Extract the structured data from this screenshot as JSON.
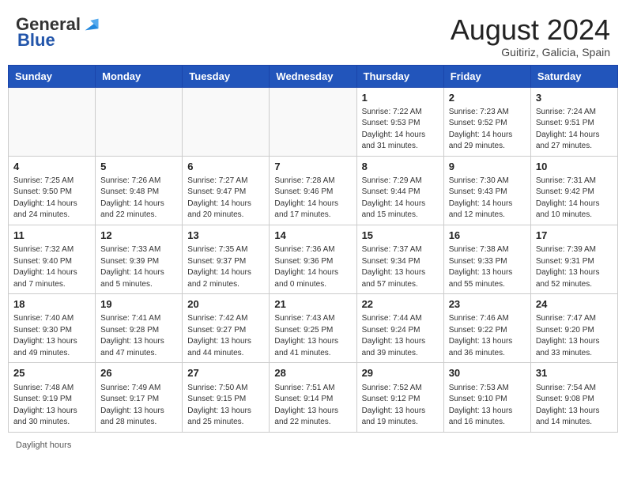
{
  "header": {
    "logo_general": "General",
    "logo_blue": "Blue",
    "month_title": "August 2024",
    "location": "Guitiriz, Galicia, Spain"
  },
  "days_of_week": [
    "Sunday",
    "Monday",
    "Tuesday",
    "Wednesday",
    "Thursday",
    "Friday",
    "Saturday"
  ],
  "weeks": [
    [
      {
        "day": "",
        "info": ""
      },
      {
        "day": "",
        "info": ""
      },
      {
        "day": "",
        "info": ""
      },
      {
        "day": "",
        "info": ""
      },
      {
        "day": "1",
        "info": "Sunrise: 7:22 AM\nSunset: 9:53 PM\nDaylight: 14 hours and 31 minutes."
      },
      {
        "day": "2",
        "info": "Sunrise: 7:23 AM\nSunset: 9:52 PM\nDaylight: 14 hours and 29 minutes."
      },
      {
        "day": "3",
        "info": "Sunrise: 7:24 AM\nSunset: 9:51 PM\nDaylight: 14 hours and 27 minutes."
      }
    ],
    [
      {
        "day": "4",
        "info": "Sunrise: 7:25 AM\nSunset: 9:50 PM\nDaylight: 14 hours and 24 minutes."
      },
      {
        "day": "5",
        "info": "Sunrise: 7:26 AM\nSunset: 9:48 PM\nDaylight: 14 hours and 22 minutes."
      },
      {
        "day": "6",
        "info": "Sunrise: 7:27 AM\nSunset: 9:47 PM\nDaylight: 14 hours and 20 minutes."
      },
      {
        "day": "7",
        "info": "Sunrise: 7:28 AM\nSunset: 9:46 PM\nDaylight: 14 hours and 17 minutes."
      },
      {
        "day": "8",
        "info": "Sunrise: 7:29 AM\nSunset: 9:44 PM\nDaylight: 14 hours and 15 minutes."
      },
      {
        "day": "9",
        "info": "Sunrise: 7:30 AM\nSunset: 9:43 PM\nDaylight: 14 hours and 12 minutes."
      },
      {
        "day": "10",
        "info": "Sunrise: 7:31 AM\nSunset: 9:42 PM\nDaylight: 14 hours and 10 minutes."
      }
    ],
    [
      {
        "day": "11",
        "info": "Sunrise: 7:32 AM\nSunset: 9:40 PM\nDaylight: 14 hours and 7 minutes."
      },
      {
        "day": "12",
        "info": "Sunrise: 7:33 AM\nSunset: 9:39 PM\nDaylight: 14 hours and 5 minutes."
      },
      {
        "day": "13",
        "info": "Sunrise: 7:35 AM\nSunset: 9:37 PM\nDaylight: 14 hours and 2 minutes."
      },
      {
        "day": "14",
        "info": "Sunrise: 7:36 AM\nSunset: 9:36 PM\nDaylight: 14 hours and 0 minutes."
      },
      {
        "day": "15",
        "info": "Sunrise: 7:37 AM\nSunset: 9:34 PM\nDaylight: 13 hours and 57 minutes."
      },
      {
        "day": "16",
        "info": "Sunrise: 7:38 AM\nSunset: 9:33 PM\nDaylight: 13 hours and 55 minutes."
      },
      {
        "day": "17",
        "info": "Sunrise: 7:39 AM\nSunset: 9:31 PM\nDaylight: 13 hours and 52 minutes."
      }
    ],
    [
      {
        "day": "18",
        "info": "Sunrise: 7:40 AM\nSunset: 9:30 PM\nDaylight: 13 hours and 49 minutes."
      },
      {
        "day": "19",
        "info": "Sunrise: 7:41 AM\nSunset: 9:28 PM\nDaylight: 13 hours and 47 minutes."
      },
      {
        "day": "20",
        "info": "Sunrise: 7:42 AM\nSunset: 9:27 PM\nDaylight: 13 hours and 44 minutes."
      },
      {
        "day": "21",
        "info": "Sunrise: 7:43 AM\nSunset: 9:25 PM\nDaylight: 13 hours and 41 minutes."
      },
      {
        "day": "22",
        "info": "Sunrise: 7:44 AM\nSunset: 9:24 PM\nDaylight: 13 hours and 39 minutes."
      },
      {
        "day": "23",
        "info": "Sunrise: 7:46 AM\nSunset: 9:22 PM\nDaylight: 13 hours and 36 minutes."
      },
      {
        "day": "24",
        "info": "Sunrise: 7:47 AM\nSunset: 9:20 PM\nDaylight: 13 hours and 33 minutes."
      }
    ],
    [
      {
        "day": "25",
        "info": "Sunrise: 7:48 AM\nSunset: 9:19 PM\nDaylight: 13 hours and 30 minutes."
      },
      {
        "day": "26",
        "info": "Sunrise: 7:49 AM\nSunset: 9:17 PM\nDaylight: 13 hours and 28 minutes."
      },
      {
        "day": "27",
        "info": "Sunrise: 7:50 AM\nSunset: 9:15 PM\nDaylight: 13 hours and 25 minutes."
      },
      {
        "day": "28",
        "info": "Sunrise: 7:51 AM\nSunset: 9:14 PM\nDaylight: 13 hours and 22 minutes."
      },
      {
        "day": "29",
        "info": "Sunrise: 7:52 AM\nSunset: 9:12 PM\nDaylight: 13 hours and 19 minutes."
      },
      {
        "day": "30",
        "info": "Sunrise: 7:53 AM\nSunset: 9:10 PM\nDaylight: 13 hours and 16 minutes."
      },
      {
        "day": "31",
        "info": "Sunrise: 7:54 AM\nSunset: 9:08 PM\nDaylight: 13 hours and 14 minutes."
      }
    ]
  ],
  "footer": {
    "label": "Daylight hours"
  }
}
